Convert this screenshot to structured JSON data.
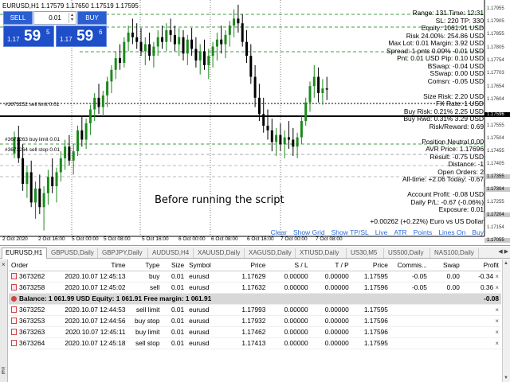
{
  "chart": {
    "header": "EURUSD,H1  1.17579 1.17650 1.17519 1.17595",
    "caption": "Before running the script",
    "pair_text": "+0.00262 (+0.22%) Euro vs US Dollar",
    "buttons": [
      "Clear",
      "Show Grid",
      "Show TP/SL",
      "Live",
      "ATR",
      "Points",
      "Lines On",
      "Buy"
    ],
    "order_labels": {
      "sell_limit": "#3673252 sell limit 0.01",
      "buy_limit": "#3673263 buy limit 0.01",
      "sell_stop": "#3673264 sell stop 0.01"
    },
    "price_scale": [
      "1.17955",
      "1.17905",
      "1.17855",
      "1.17805",
      "1.17754",
      "1.17703",
      "1.17654",
      "1.17604",
      "1.17596",
      "1.17555",
      "1.17504",
      "1.17455",
      "1.17405",
      "1.17355",
      "1.17304",
      "1.17255",
      "1.17204",
      "1.17154",
      "1.17055",
      "1.16954"
    ],
    "date_labels": [
      "2 Oct 2020",
      "2 Oct 16:00",
      "5 Oct 00:00",
      "5 Oct 08:00",
      "5 Oct 16:00",
      "6 Oct 00:00",
      "6 Oct 08:00",
      "6 Oct 16:00",
      "7 Oct 00:00",
      "7 Oct 08:00"
    ]
  },
  "trade_panel": {
    "sell_label": "SELL",
    "buy_label": "BUY",
    "lot": "0.01",
    "sell_small": "1.17",
    "sell_big": "59",
    "sell_sup": "5",
    "buy_small": "1.17",
    "buy_big": "59",
    "buy_sup": "6"
  },
  "info_lines": [
    "Range: 131 Time: 12:31",
    "SL: 220 TP: 330",
    "Equity: 1061.91 USD",
    "Risk 24.00%: 254.86 USD",
    "Max Lot: 0.01 Margin: 3.92 USD",
    "Spread: 1 pnts 0.00% -0.01 USD",
    "Pnt: 0.01 USD Pip: 0.10 USD",
    "BSwap: -0.04 USD",
    "SSwap: 0.00 USD",
    "Comsn: -0.05 USD",
    "",
    "Size Risk: 2.20 USD",
    "FX Rate: 1 USD",
    "Buy Risk: 0.21% 2.25 USD",
    "Buy Rwd: 0.31% 3.29 USD",
    "Risk/Reward: 0.69",
    "",
    "Position Neutral 0.00",
    "AVR Price: 1.17696",
    "Result: -0.75 USD",
    "Distance: -1",
    "Open Orders: 2",
    "All-time: +2.06 Today: -0.67",
    "",
    "Account Profit: -0.08 USD",
    "Daily P/L: -0.67 (-0.06%)",
    "Exposure: 0.01"
  ],
  "tabs": [
    "EURUSD,H1",
    "GBPUSD,Daily",
    "GBPJPY,Daily",
    "AUDUSD,H4",
    "XAUUSD,Daily",
    "XAGUSD,Daily",
    "XTIUSD,Daily",
    "US30,M5",
    "US500,Daily",
    "NAS100,Daily"
  ],
  "terminal": {
    "columns": [
      "Order",
      "Time",
      "Type",
      "Size",
      "Symbol",
      "Price",
      "S / L",
      "T / P",
      "Price",
      "Commis...",
      "Swap",
      "Profit"
    ],
    "open_rows": [
      [
        "3673262",
        "2020.10.07 12:45:13",
        "buy",
        "0.01",
        "eurusd",
        "1.17629",
        "0.00000",
        "0.00000",
        "1.17595",
        "-0.05",
        "0.00",
        "-0.34"
      ],
      [
        "3673258",
        "2020.10.07 12:45:02",
        "sell",
        "0.01",
        "eurusd",
        "1.17632",
        "0.00000",
        "0.00000",
        "1.17596",
        "-0.05",
        "0.00",
        "0.36"
      ]
    ],
    "balance_text": "Balance: 1 061.99 USD  Equity: 1 061.91  Free margin: 1 061.91",
    "balance_profit": "-0.08",
    "pending_rows": [
      [
        "3673252",
        "2020.10.07 12:44:53",
        "sell limit",
        "0.01",
        "eurusd",
        "1.17993",
        "0.00000",
        "0.00000",
        "1.17595"
      ],
      [
        "3673253",
        "2020.10.07 12:44:56",
        "buy stop",
        "0.01",
        "eurusd",
        "1.17932",
        "0.00000",
        "0.00000",
        "1.17596"
      ],
      [
        "3673263",
        "2020.10.07 12:45:11",
        "buy limit",
        "0.01",
        "eurusd",
        "1.17462",
        "0.00000",
        "0.00000",
        "1.17596"
      ],
      [
        "3673264",
        "2020.10.07 12:45:18",
        "sell stop",
        "0.01",
        "eurusd",
        "1.17413",
        "0.00000",
        "0.00000",
        "1.17595"
      ]
    ]
  },
  "candles": [
    [
      1.1732,
      1.17415,
      1.173,
      1.1739
    ],
    [
      1.1739,
      1.1744,
      1.1728,
      1.173
    ],
    [
      1.173,
      1.1736,
      1.1716,
      1.1719
    ],
    [
      1.1719,
      1.1727,
      1.1713,
      1.1724
    ],
    [
      1.1724,
      1.1729,
      1.1709,
      1.1711
    ],
    [
      1.1711,
      1.172,
      1.1704,
      1.1717
    ],
    [
      1.1717,
      1.1723,
      1.1706,
      1.1709
    ],
    [
      1.1709,
      1.1718,
      1.1699,
      1.1715
    ],
    [
      1.1715,
      1.1725,
      1.171,
      1.1722
    ],
    [
      1.1722,
      1.173,
      1.1715,
      1.1718
    ],
    [
      1.1718,
      1.1726,
      1.1711,
      1.1724
    ],
    [
      1.1724,
      1.1733,
      1.172,
      1.173
    ],
    [
      1.173,
      1.1738,
      1.1725,
      1.1735
    ],
    [
      1.1735,
      1.174,
      1.1727,
      1.1729
    ],
    [
      1.1729,
      1.1736,
      1.1723,
      1.1733
    ],
    [
      1.1733,
      1.1744,
      1.1731,
      1.1742
    ],
    [
      1.1742,
      1.1748,
      1.1735,
      1.1738
    ],
    [
      1.1738,
      1.1747,
      1.1734,
      1.1745
    ],
    [
      1.1745,
      1.1753,
      1.174,
      1.1751
    ],
    [
      1.1751,
      1.1758,
      1.1746,
      1.1756
    ],
    [
      1.1756,
      1.1762,
      1.1749,
      1.1752
    ],
    [
      1.1752,
      1.1759,
      1.1748,
      1.1757
    ],
    [
      1.1757,
      1.1765,
      1.1752,
      1.1763
    ],
    [
      1.1763,
      1.177,
      1.1758,
      1.1768
    ],
    [
      1.1768,
      1.1776,
      1.1764,
      1.1773
    ],
    [
      1.1773,
      1.1779,
      1.1768,
      1.1771
    ],
    [
      1.1771,
      1.1782,
      1.1769,
      1.178
    ],
    [
      1.178,
      1.1787,
      1.1776,
      1.1784
    ],
    [
      1.1784,
      1.179,
      1.1779,
      1.1782
    ],
    [
      1.1782,
      1.1788,
      1.1777,
      1.178
    ],
    [
      1.178,
      1.1786,
      1.1774,
      1.1776
    ],
    [
      1.1776,
      1.1782,
      1.177,
      1.1779
    ],
    [
      1.1779,
      1.1784,
      1.1772,
      1.1774
    ],
    [
      1.1774,
      1.178,
      1.1769,
      1.1778
    ],
    [
      1.1778,
      1.1785,
      1.1774,
      1.1782
    ],
    [
      1.1782,
      1.1787,
      1.1777,
      1.178
    ],
    [
      1.178,
      1.1788,
      1.1776,
      1.1785
    ],
    [
      1.1785,
      1.179,
      1.178,
      1.1783
    ],
    [
      1.1783,
      1.1787,
      1.1776,
      1.1779
    ],
    [
      1.1779,
      1.1786,
      1.1774,
      1.1782
    ],
    [
      1.1782,
      1.1785,
      1.1772,
      1.1775
    ],
    [
      1.1775,
      1.1783,
      1.177,
      1.1781
    ],
    [
      1.1781,
      1.1786,
      1.1774,
      1.1777
    ],
    [
      1.1777,
      1.1782,
      1.1769,
      1.1772
    ],
    [
      1.1772,
      1.1779,
      1.1766,
      1.1776
    ],
    [
      1.1776,
      1.1781,
      1.1768,
      1.177
    ],
    [
      1.177,
      1.1777,
      1.1764,
      1.1774
    ],
    [
      1.1774,
      1.178,
      1.1769,
      1.1778
    ],
    [
      1.1778,
      1.1784,
      1.1772,
      1.1781
    ],
    [
      1.1781,
      1.1787,
      1.1775,
      1.1779
    ],
    [
      1.1779,
      1.1785,
      1.1773,
      1.1783
    ],
    [
      1.1783,
      1.1789,
      1.1778,
      1.1787
    ],
    [
      1.1787,
      1.1794,
      1.1782,
      1.179
    ],
    [
      1.179,
      1.1796,
      1.1784,
      1.1788
    ],
    [
      1.1788,
      1.1792,
      1.1778,
      1.178
    ],
    [
      1.178,
      1.1785,
      1.1771,
      1.1774
    ],
    [
      1.1774,
      1.1779,
      1.1762,
      1.1765
    ],
    [
      1.1765,
      1.177,
      1.1752,
      1.1756
    ],
    [
      1.1756,
      1.1762,
      1.1746,
      1.1749
    ],
    [
      1.1749,
      1.1756,
      1.1741,
      1.1744
    ],
    [
      1.1744,
      1.1751,
      1.1738,
      1.1742
    ],
    [
      1.1742,
      1.1747,
      1.1733,
      1.1737
    ],
    [
      1.1737,
      1.1743,
      1.1731,
      1.174
    ],
    [
      1.174,
      1.1745,
      1.1733,
      1.1736
    ],
    [
      1.1736,
      1.1742,
      1.173,
      1.1739
    ],
    [
      1.1739,
      1.1746,
      1.1734,
      1.1738
    ],
    [
      1.1738,
      1.1743,
      1.1731,
      1.1735
    ],
    [
      1.1735,
      1.1741,
      1.173,
      1.1739
    ],
    [
      1.1739,
      1.1748,
      1.1736,
      1.1746
    ],
    [
      1.1746,
      1.1756,
      1.1744,
      1.1754
    ],
    [
      1.1754,
      1.1763,
      1.175,
      1.1761
    ],
    [
      1.1761,
      1.177,
      1.1756,
      1.1765
    ],
    [
      1.1765,
      1.1769,
      1.1754,
      1.1758
    ],
    [
      1.1758,
      1.1764,
      1.1753,
      1.176
    ],
    [
      1.176,
      1.1765,
      1.1755,
      1.17595
    ]
  ]
}
